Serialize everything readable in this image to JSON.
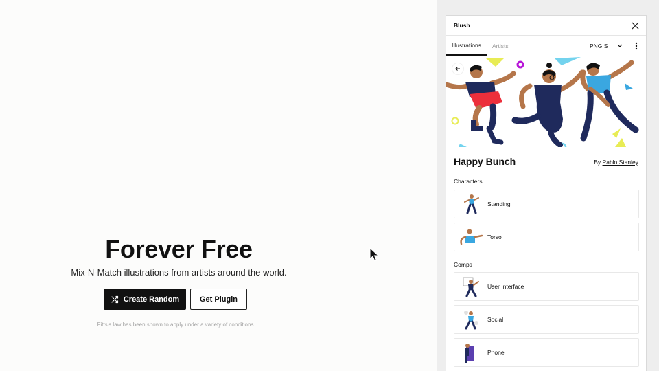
{
  "hero": {
    "title": "Forever Free",
    "subtitle": "Mix-N-Match illustrations from artists around the world.",
    "create_random_label": "Create Random",
    "get_plugin_label": "Get Plugin",
    "note": "Fitts's law has been shown to apply under a variety of conditions"
  },
  "panel": {
    "title": "Blush",
    "tabs": [
      {
        "label": "Illustrations",
        "active": true
      },
      {
        "label": "Artists",
        "active": false
      }
    ],
    "format_value": "PNG S",
    "pack": {
      "title": "Happy Bunch",
      "by_prefix": "By",
      "author": "Pablo Stanley"
    },
    "sections": [
      {
        "label": "Characters",
        "items": [
          {
            "label": "Standing"
          },
          {
            "label": "Torso"
          }
        ]
      },
      {
        "label": "Comps",
        "items": [
          {
            "label": "User Interface"
          },
          {
            "label": "Social"
          },
          {
            "label": "Phone"
          }
        ]
      }
    ]
  },
  "colors": {
    "accent_dark": "#111111",
    "skin": "#b5764a",
    "navy": "#1f2a5c",
    "red": "#ec2f3b",
    "blue": "#3aa7e0",
    "yellow": "#e8ec55",
    "purple": "#b716d8",
    "sky": "#73d3ee"
  },
  "icons": {
    "shuffle": "shuffle-icon",
    "close": "close-icon",
    "chevron": "chevron-down-icon",
    "more": "more-vertical-icon",
    "back": "arrow-left-icon",
    "cursor": "mouse-cursor-icon"
  }
}
